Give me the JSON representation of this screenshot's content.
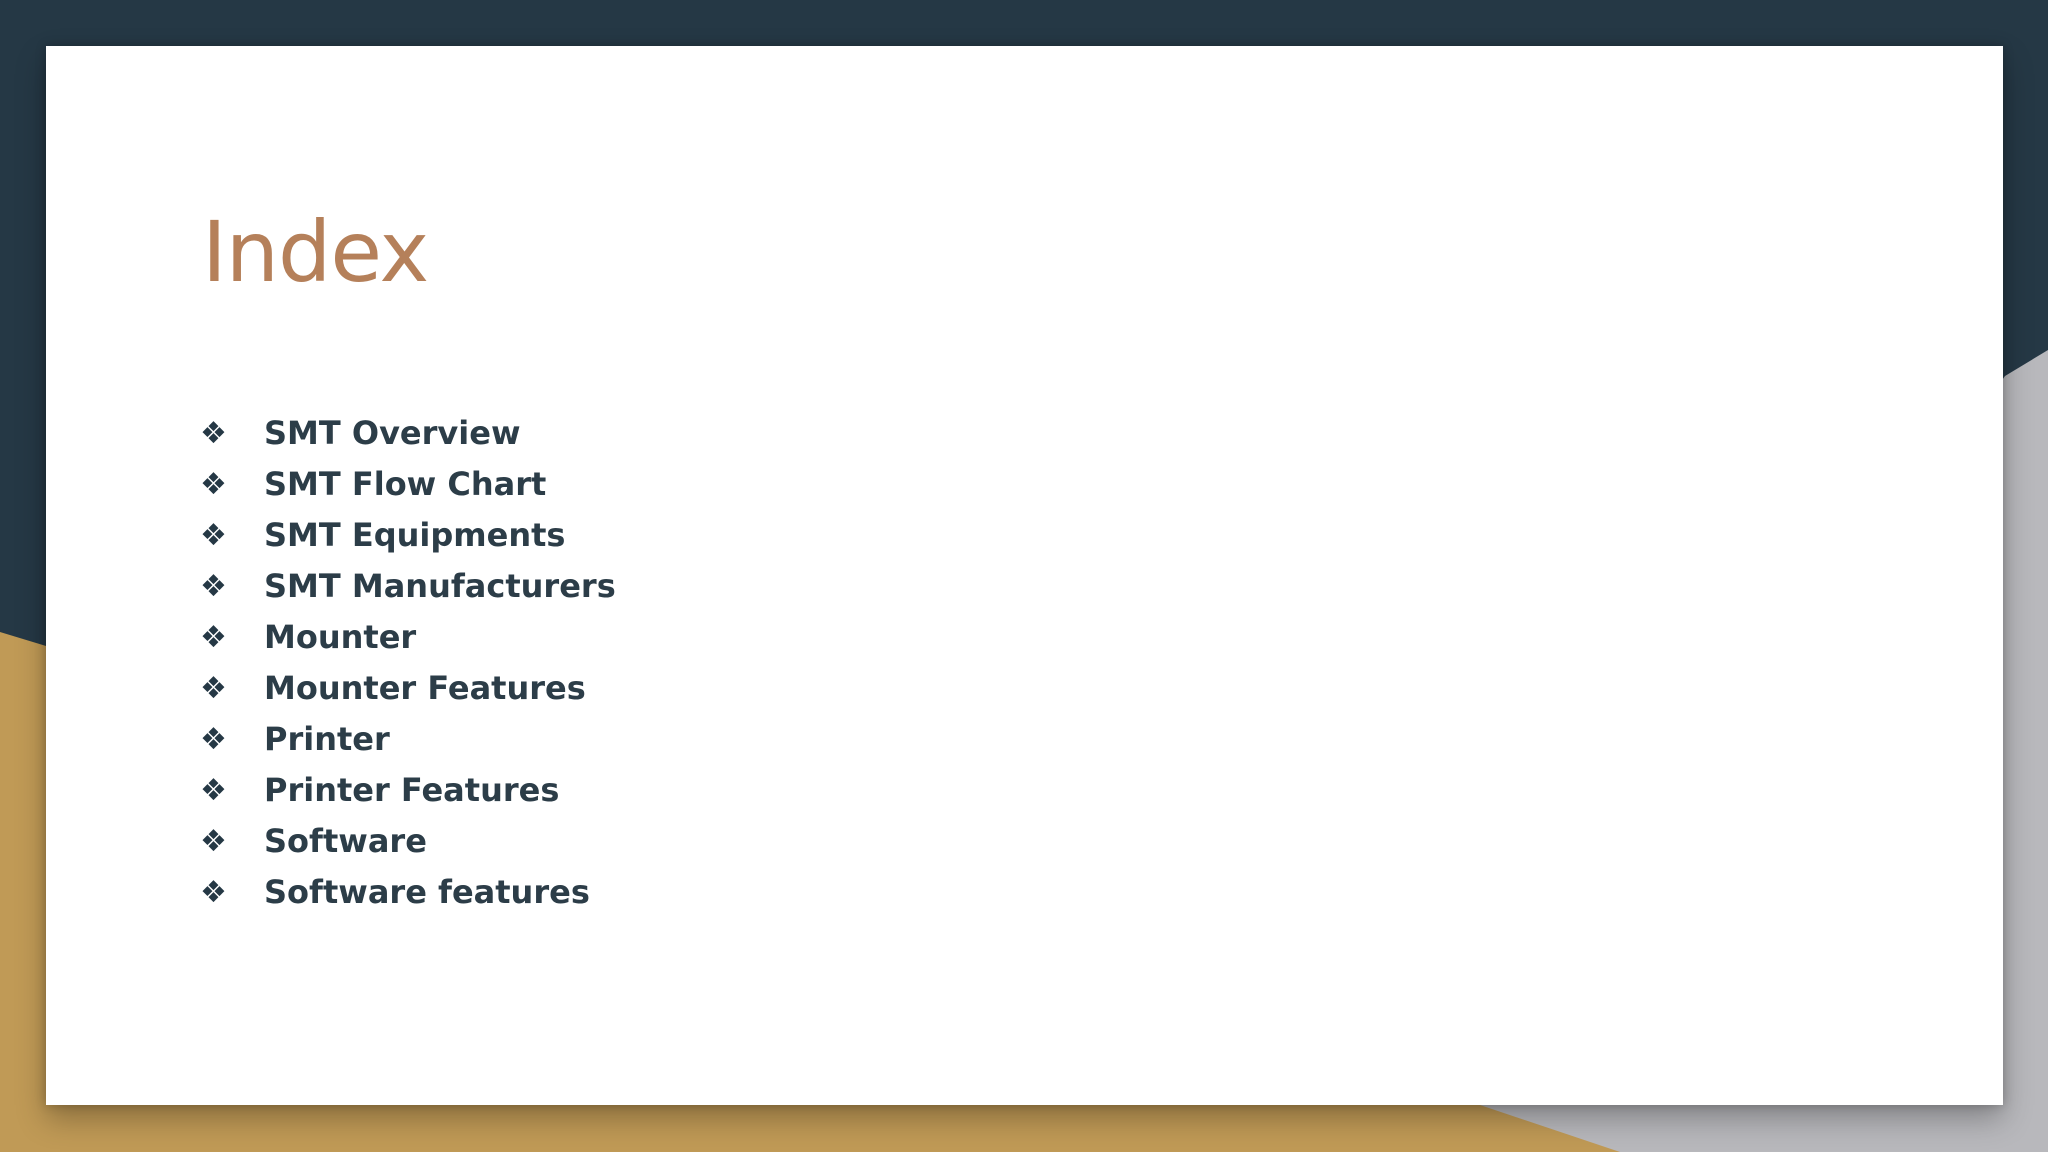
{
  "slide": {
    "title": "Index",
    "bullet_icon": "four-diamond-icon",
    "items": [
      {
        "label": "SMT Overview"
      },
      {
        "label": "SMT Flow Chart"
      },
      {
        "label": "SMT Equipments"
      },
      {
        "label": "SMT Manufacturers"
      },
      {
        "label": "Mounter"
      },
      {
        "label": "Mounter Features"
      },
      {
        "label": "Printer"
      },
      {
        "label": "Printer Features"
      },
      {
        "label": "Software"
      },
      {
        "label": "Software features"
      }
    ]
  },
  "colors": {
    "background_dark": "#253845",
    "accent_gold": "#c09a56",
    "accent_gray": "#b8b8bc",
    "title_color": "#b5805a",
    "text_color": "#2c3d48"
  }
}
